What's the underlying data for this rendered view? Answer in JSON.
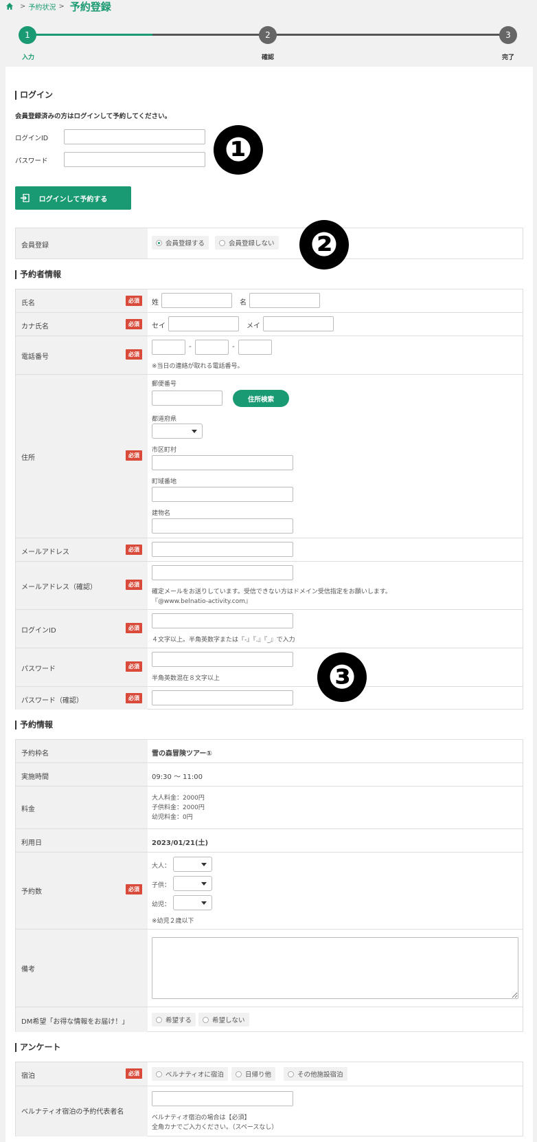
{
  "breadcrumb": {
    "home_icon": "home-icon",
    "link": "予約状況",
    "separator": ">",
    "title": "予約登録"
  },
  "colors": {
    "accent": "#1a9a72",
    "inactive": "#666666",
    "required": "#d94a3a"
  },
  "steps": [
    {
      "num": "1",
      "label": "入力",
      "active": true
    },
    {
      "num": "2",
      "label": "確認",
      "active": false
    },
    {
      "num": "3",
      "label": "完了",
      "active": false
    }
  ],
  "login": {
    "title": "ログイン",
    "desc": "会員登録済みの方はログインして予約してください。",
    "id_label": "ログインID",
    "password_label": "パスワード",
    "button": "ログインして予約する"
  },
  "membership": {
    "label": "会員登録",
    "options": [
      {
        "label": "会員登録する",
        "selected": true
      },
      {
        "label": "会員登録しない",
        "selected": false
      }
    ]
  },
  "required": "必須",
  "annotations": [
    "❶",
    "❷",
    "❸"
  ],
  "booker": {
    "title": "予約者情報",
    "name": {
      "label": "氏名",
      "last": "姓",
      "first": "名"
    },
    "kana": {
      "label": "カナ氏名",
      "last": "セイ",
      "first": "メイ"
    },
    "phone": {
      "label": "電話番号",
      "dash": "-",
      "note": "※当日の連絡が取れる電話番号。"
    },
    "address": {
      "label": "住所",
      "zip": "郵便番号",
      "search": "住所検索",
      "pref": "都道府県",
      "city": "市区町村",
      "town": "町域番地",
      "building": "建物名"
    },
    "email": {
      "label": "メールアドレス"
    },
    "email_confirm": {
      "label": "メールアドレス（確認）",
      "note1": "確定メールをお送りしています。受信できない方はドメイン受信指定をお願いします。",
      "note2": "『@www.belnatio-activity.com』"
    },
    "login_id": {
      "label": "ログインID",
      "note": "４文字以上。半角英数字または『-』『.』『_』で入力"
    },
    "password": {
      "label": "パスワード",
      "note": "半角英数混在８文字以上"
    },
    "password_confirm": {
      "label": "パスワード（確認）"
    }
  },
  "reservation": {
    "title": "予約情報",
    "plan": {
      "label": "予約枠名",
      "value": "雪の森冒険ツアー①"
    },
    "time": {
      "label": "実施時間",
      "value": "09:30 ～ 11:00"
    },
    "fee": {
      "label": "料金",
      "lines": [
        "大人料金：2000円",
        "子供料金：2000円",
        "幼児料金：0円"
      ]
    },
    "date": {
      "label": "利用日",
      "value": "2023/01/21(土)"
    },
    "count": {
      "label": "予約数",
      "adult": "大人：",
      "child": "子供：",
      "infant": "幼児：",
      "note": "※幼児２歳以下"
    },
    "remarks": {
      "label": "備考"
    },
    "dm": {
      "label": "DM希望「お得な情報をお届け！」",
      "options": [
        {
          "label": "希望する",
          "selected": false
        },
        {
          "label": "希望しない",
          "selected": false
        }
      ]
    }
  },
  "survey": {
    "title": "アンケート",
    "stay": {
      "label": "宿泊",
      "options": [
        {
          "label": "ベルナティオに宿泊",
          "selected": false
        },
        {
          "label": "日帰り他",
          "selected": false
        },
        {
          "label": "その他施設宿泊",
          "selected": false
        }
      ]
    },
    "rep": {
      "label": "ベルナティオ宿泊の予約代表者名",
      "note1": "ベルナティオ宿泊の場合は【必須】",
      "note2": "全角カナでご入力ください。（スペースなし）"
    }
  }
}
